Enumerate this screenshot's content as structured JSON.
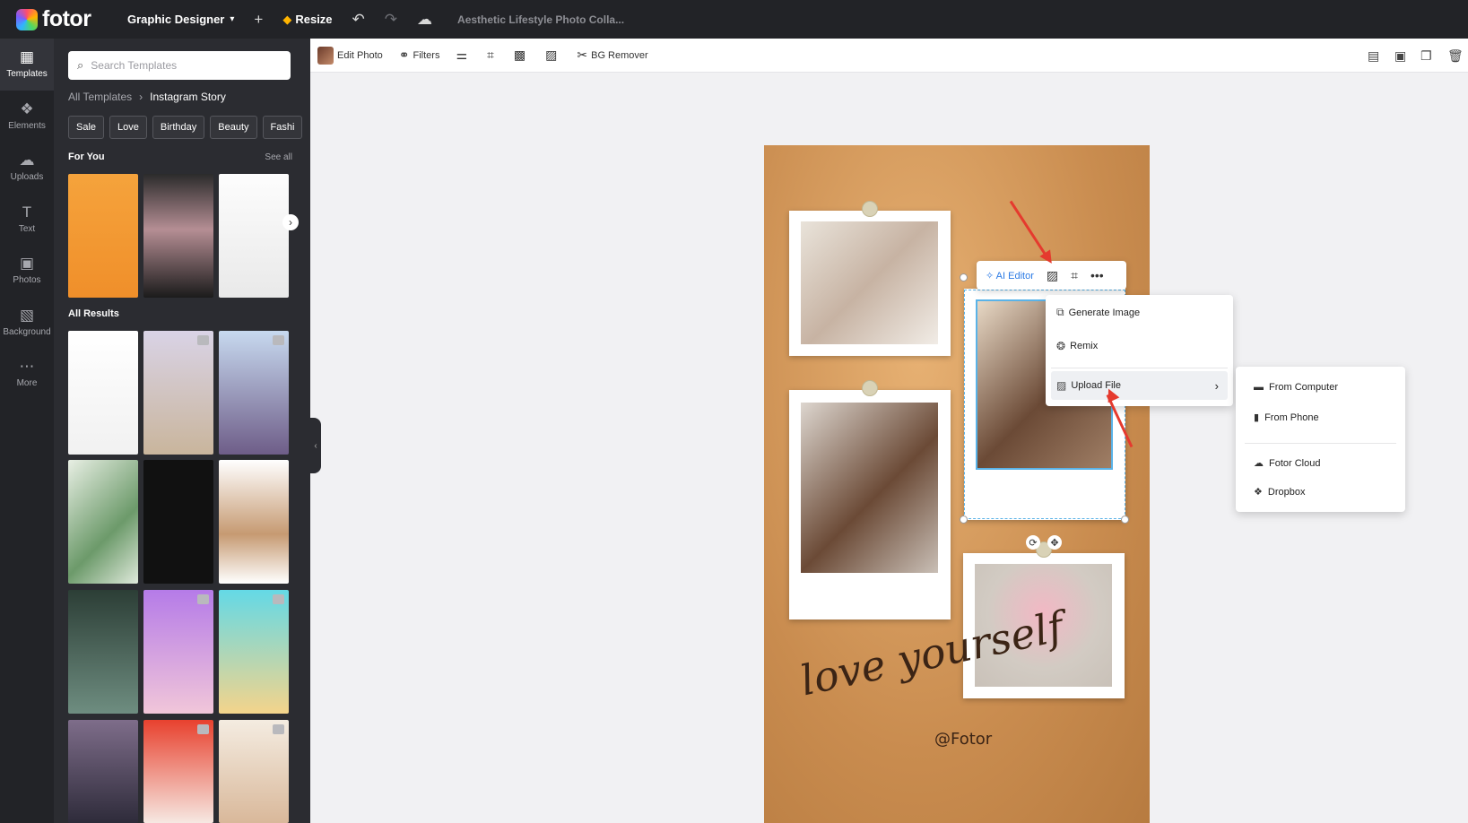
{
  "app": {
    "logo_text": "fotor",
    "workspace": "Graphic Designer",
    "resize_label": "Resize",
    "doc_title": "Aesthetic Lifestyle Photo Colla..."
  },
  "rail": {
    "items": [
      {
        "label": "Templates",
        "icon": "templates-icon"
      },
      {
        "label": "Elements",
        "icon": "elements-icon"
      },
      {
        "label": "Uploads",
        "icon": "upload-icon"
      },
      {
        "label": "Text",
        "icon": "text-icon"
      },
      {
        "label": "Photos",
        "icon": "photos-icon"
      },
      {
        "label": "Background",
        "icon": "background-icon"
      },
      {
        "label": "More",
        "icon": "more-icon"
      }
    ]
  },
  "panel": {
    "search_placeholder": "Search Templates",
    "breadcrumb": {
      "root": "All Templates",
      "current": "Instagram Story"
    },
    "chips": [
      "Sale",
      "Love",
      "Birthday",
      "Beauty",
      "Fashi"
    ],
    "for_you": "For You",
    "see_all": "See all",
    "all_results": "All Results"
  },
  "toolbar": {
    "edit_photo": "Edit Photo",
    "filters": "Filters",
    "bg_remover": "BG Remover"
  },
  "canvas": {
    "script_text": "love yourself",
    "handle": "@Fotor"
  },
  "context_toolbar": {
    "ai_editor": "AI Editor"
  },
  "menu": {
    "generate_image": "Generate Image",
    "remix": "Remix",
    "upload_file": "Upload File"
  },
  "submenu": {
    "from_computer": "From Computer",
    "from_phone": "From Phone",
    "fotor_cloud": "Fotor Cloud",
    "dropbox": "Dropbox"
  },
  "colors": {
    "topbar": "#222327",
    "panel": "#2b2c31",
    "accent_arrow": "#e53a2e",
    "selection": "#5ab3e8"
  }
}
